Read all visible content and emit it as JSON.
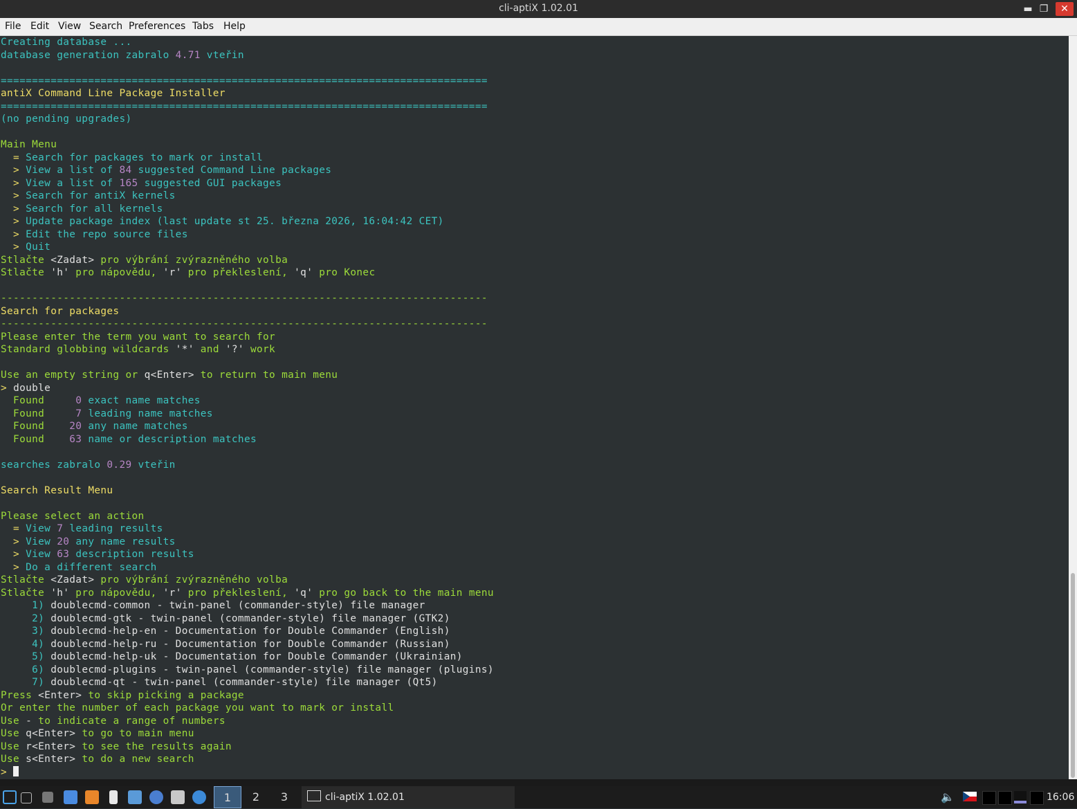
{
  "window": {
    "title": "cli-aptiX 1.02.01"
  },
  "menu": [
    "File",
    "Edit",
    "View",
    "Search",
    "Preferences",
    "Tabs",
    "Help"
  ],
  "colors": {
    "cyan": "#3cc4c0",
    "green": "#9ddc3a",
    "yellow": "#f0de66",
    "white": "#e0e0e0",
    "purple": "#b786c6"
  },
  "terminal_lines": [
    [
      [
        "c",
        "Creating database ..."
      ]
    ],
    [
      [
        "c",
        "database generation zabralo "
      ],
      [
        "p",
        "4.71"
      ],
      [
        "c",
        " vteřin"
      ]
    ],
    [],
    [
      [
        "c",
        "=============================================================================="
      ]
    ],
    [
      [
        "y",
        "antiX Command Line Package Installer"
      ]
    ],
    [
      [
        "c",
        "=============================================================================="
      ]
    ],
    [
      [
        "c",
        "(no pending upgrades)"
      ]
    ],
    [],
    [
      [
        "g",
        "Main Menu"
      ]
    ],
    [
      [
        "y",
        "  = "
      ],
      [
        "c",
        "Search for packages to mark or install"
      ]
    ],
    [
      [
        "y",
        "  > "
      ],
      [
        "c",
        "View a list of "
      ],
      [
        "p",
        "84"
      ],
      [
        "c",
        " suggested Command Line packages"
      ]
    ],
    [
      [
        "y",
        "  > "
      ],
      [
        "c",
        "View a list of "
      ],
      [
        "p",
        "165"
      ],
      [
        "c",
        " suggested GUI packages"
      ]
    ],
    [
      [
        "y",
        "  > "
      ],
      [
        "c",
        "Search for antiX kernels"
      ]
    ],
    [
      [
        "y",
        "  > "
      ],
      [
        "c",
        "Search for all kernels"
      ]
    ],
    [
      [
        "y",
        "  > "
      ],
      [
        "c",
        "Update package index (last update st 25. března 2026, 16:04:42 CET)"
      ]
    ],
    [
      [
        "y",
        "  > "
      ],
      [
        "c",
        "Edit the repo source files"
      ]
    ],
    [
      [
        "y",
        "  > "
      ],
      [
        "c",
        "Quit"
      ]
    ],
    [
      [
        "g",
        "Stlačte "
      ],
      [
        "w",
        "<Zadat>"
      ],
      [
        "g",
        " pro výbrání zvýrazněného volba"
      ]
    ],
    [
      [
        "g",
        "Stlačte "
      ],
      [
        "w",
        "'h'"
      ],
      [
        "g",
        " pro nápovědu, "
      ],
      [
        "w",
        "'r'"
      ],
      [
        "g",
        " pro překleslení, "
      ],
      [
        "w",
        "'q'"
      ],
      [
        "g",
        " pro Konec"
      ]
    ],
    [],
    [
      [
        "g",
        "------------------------------------------------------------------------------"
      ]
    ],
    [
      [
        "y",
        "Search for packages"
      ]
    ],
    [
      [
        "g",
        "------------------------------------------------------------------------------"
      ]
    ],
    [
      [
        "g",
        "Please enter the term you want to search for"
      ]
    ],
    [
      [
        "g",
        "Standard globbing wildcards "
      ],
      [
        "w",
        "'*'"
      ],
      [
        "g",
        " and "
      ],
      [
        "w",
        "'?'"
      ],
      [
        "g",
        " work"
      ]
    ],
    [],
    [
      [
        "g",
        "Use an empty string or "
      ],
      [
        "w",
        "q<Enter>"
      ],
      [
        "g",
        " to return to main menu"
      ]
    ],
    [
      [
        "y",
        "> "
      ],
      [
        "w",
        "double"
      ]
    ],
    [
      [
        "g",
        "  Found     "
      ],
      [
        "p",
        "0"
      ],
      [
        "c",
        " exact name matches"
      ]
    ],
    [
      [
        "g",
        "  Found     "
      ],
      [
        "p",
        "7"
      ],
      [
        "c",
        " leading name matches"
      ]
    ],
    [
      [
        "g",
        "  Found    "
      ],
      [
        "p",
        "20"
      ],
      [
        "c",
        " any name matches"
      ]
    ],
    [
      [
        "g",
        "  Found    "
      ],
      [
        "p",
        "63"
      ],
      [
        "c",
        " name or description matches"
      ]
    ],
    [],
    [
      [
        "c",
        "searches zabralo "
      ],
      [
        "p",
        "0.29"
      ],
      [
        "c",
        " vteřin"
      ]
    ],
    [],
    [
      [
        "y",
        "Search Result Menu"
      ]
    ],
    [],
    [
      [
        "g",
        "Please select an action"
      ]
    ],
    [
      [
        "y",
        "  = "
      ],
      [
        "c",
        "View "
      ],
      [
        "p",
        "7"
      ],
      [
        "c",
        " leading results"
      ]
    ],
    [
      [
        "y",
        "  > "
      ],
      [
        "c",
        "View "
      ],
      [
        "p",
        "20"
      ],
      [
        "c",
        " any name results"
      ]
    ],
    [
      [
        "y",
        "  > "
      ],
      [
        "c",
        "View "
      ],
      [
        "p",
        "63"
      ],
      [
        "c",
        " description results"
      ]
    ],
    [
      [
        "y",
        "  > "
      ],
      [
        "c",
        "Do a different search"
      ]
    ],
    [
      [
        "g",
        "Stlačte "
      ],
      [
        "w",
        "<Zadat>"
      ],
      [
        "g",
        " pro výbrání zvýrazněného volba"
      ]
    ],
    [
      [
        "g",
        "Stlačte "
      ],
      [
        "w",
        "'h'"
      ],
      [
        "g",
        " pro nápovědu, "
      ],
      [
        "w",
        "'r'"
      ],
      [
        "g",
        " pro překleslení, "
      ],
      [
        "w",
        "'q'"
      ],
      [
        "g",
        " pro go back to the main menu"
      ]
    ],
    [
      [
        "c",
        "     1)"
      ],
      [
        "w",
        " doublecmd-common - twin-panel (commander-style) file manager"
      ]
    ],
    [
      [
        "c",
        "     2)"
      ],
      [
        "w",
        " doublecmd-gtk - twin-panel (commander-style) file manager (GTK2)"
      ]
    ],
    [
      [
        "c",
        "     3)"
      ],
      [
        "w",
        " doublecmd-help-en - Documentation for Double Commander (English)"
      ]
    ],
    [
      [
        "c",
        "     4)"
      ],
      [
        "w",
        " doublecmd-help-ru - Documentation for Double Commander (Russian)"
      ]
    ],
    [
      [
        "c",
        "     5)"
      ],
      [
        "w",
        " doublecmd-help-uk - Documentation for Double Commander (Ukrainian)"
      ]
    ],
    [
      [
        "c",
        "     6)"
      ],
      [
        "w",
        " doublecmd-plugins - twin-panel (commander-style) file manager (plugins)"
      ]
    ],
    [
      [
        "c",
        "     7)"
      ],
      [
        "w",
        " doublecmd-qt - twin-panel (commander-style) file manager (Qt5)"
      ]
    ],
    [
      [
        "g",
        "Press "
      ],
      [
        "w",
        "<Enter>"
      ],
      [
        "g",
        " to skip picking a package"
      ]
    ],
    [
      [
        "g",
        "Or enter the number of each package you want to mark or install"
      ]
    ],
    [
      [
        "g",
        "Use "
      ],
      [
        "w",
        "-"
      ],
      [
        "g",
        " to indicate a range of numbers"
      ]
    ],
    [
      [
        "g",
        "Use "
      ],
      [
        "w",
        "q<Enter>"
      ],
      [
        "g",
        " to go to main menu"
      ]
    ],
    [
      [
        "g",
        "Use "
      ],
      [
        "w",
        "r<Enter>"
      ],
      [
        "g",
        " to see the results again"
      ]
    ],
    [
      [
        "g",
        "Use "
      ],
      [
        "w",
        "s<Enter>"
      ],
      [
        "g",
        " to do a new search"
      ]
    ],
    [
      [
        "y",
        "> "
      ]
    ]
  ],
  "taskbar": {
    "workspaces": [
      "1",
      "2",
      "3"
    ],
    "task_title": "cli-aptiX 1.02.01",
    "clock": "16:06"
  }
}
